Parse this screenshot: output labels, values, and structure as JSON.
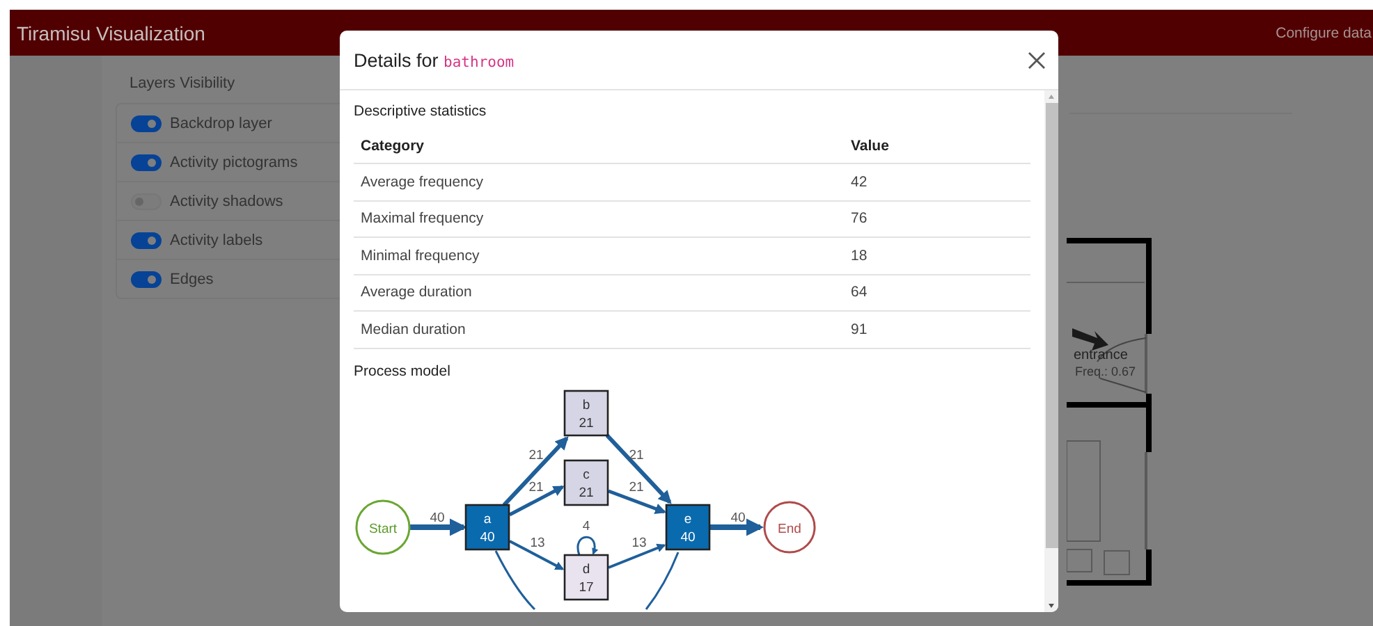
{
  "navbar": {
    "title": "Tiramisu Visualization",
    "link": "Configure data"
  },
  "sidebar": {
    "title": "Layers Visibility",
    "layers": [
      {
        "label": "Backdrop layer",
        "on": true
      },
      {
        "label": "Activity pictograms",
        "on": true
      },
      {
        "label": "Activity shadows",
        "on": false
      },
      {
        "label": "Activity labels",
        "on": true
      },
      {
        "label": "Edges",
        "on": true
      }
    ]
  },
  "floor_plan": {
    "room_label": "entrance",
    "room_freq": "Freq.: 0.67"
  },
  "modal": {
    "title": "Details for",
    "subject": "bathroom",
    "stats_heading": "Descriptive statistics",
    "columns": [
      "Category",
      "Value"
    ],
    "rows": [
      [
        "Average frequency",
        "42"
      ],
      [
        "Maximal frequency",
        "76"
      ],
      [
        "Minimal frequency",
        "18"
      ],
      [
        "Average duration",
        "64"
      ],
      [
        "Median duration",
        "91"
      ]
    ],
    "process_heading": "Process model",
    "nodes": [
      {
        "kind": "start",
        "label": "Start"
      },
      {
        "kind": "activity",
        "label": "a",
        "count": "40",
        "color": "#0a6aae"
      },
      {
        "kind": "activity",
        "label": "b",
        "count": "21",
        "color": "#d5d5e6"
      },
      {
        "kind": "activity",
        "label": "c",
        "count": "21",
        "color": "#d5d5e6"
      },
      {
        "kind": "activity",
        "label": "d",
        "count": "17",
        "color": "#e8e3ef"
      },
      {
        "kind": "activity",
        "label": "e",
        "count": "40",
        "color": "#0a6aae"
      },
      {
        "kind": "end",
        "label": "End"
      }
    ],
    "edges": [
      {
        "kind": "line",
        "label": "40"
      },
      {
        "kind": "line",
        "label": "21"
      },
      {
        "kind": "line",
        "label": "21"
      },
      {
        "kind": "line",
        "label": "13"
      },
      {
        "kind": "loop",
        "label": "4"
      },
      {
        "kind": "line",
        "label": "21"
      },
      {
        "kind": "line",
        "label": "21"
      },
      {
        "kind": "line",
        "label": "13"
      },
      {
        "kind": "line",
        "label": "40"
      },
      {
        "kind": "curve"
      },
      {
        "kind": "curve"
      }
    ]
  }
}
